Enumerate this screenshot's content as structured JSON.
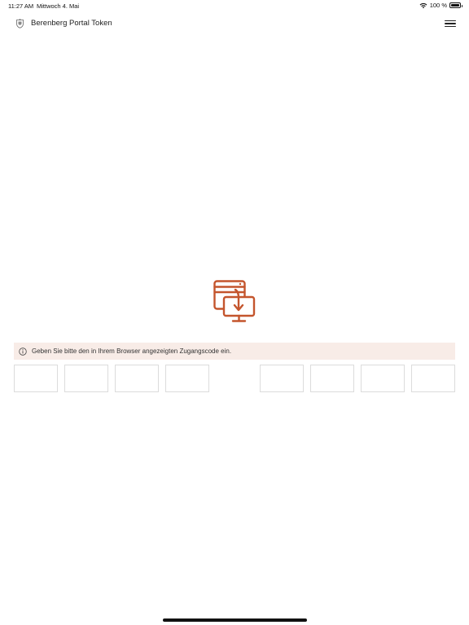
{
  "status_bar": {
    "time": "11:27 AM",
    "date": "Mittwoch 4. Mai",
    "battery": "100 %",
    "battery_level": 1.0
  },
  "app_bar": {
    "title": "Berenberg Portal Token",
    "logo_icon": "berenberg-crest-icon",
    "menu_icon": "hamburger-menu-icon"
  },
  "main": {
    "central_icon": "browser-download-monitor-icon",
    "accent_color": "#c4552d",
    "info_banner": {
      "icon": "info-icon",
      "text": "Geben Sie bitte den in Ihrem Browser angezeigten Zugangscode ein.",
      "background": "#f8ece7"
    },
    "code_inputs": {
      "groups": 2,
      "per_group": 4,
      "values": [
        "",
        "",
        "",
        "",
        "",
        "",
        "",
        ""
      ]
    }
  }
}
